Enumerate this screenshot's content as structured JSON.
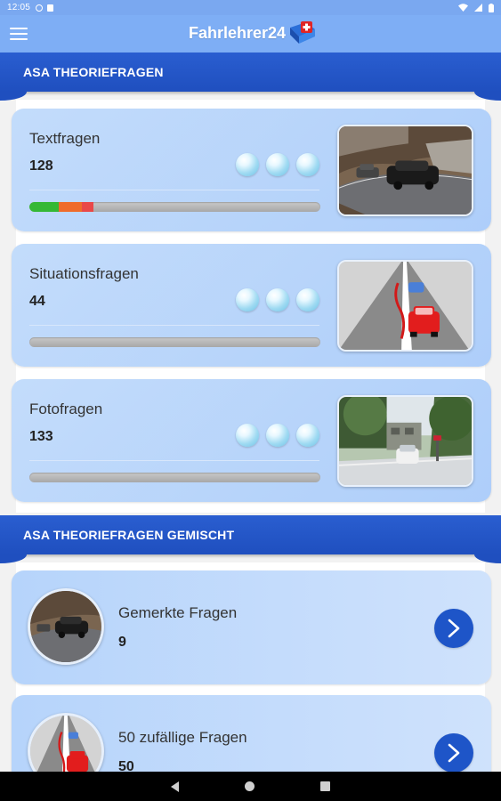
{
  "status_bar": {
    "time": "12:05",
    "icons": [
      "notification-icon",
      "sim-icon",
      "wifi-icon",
      "signal-icon",
      "battery-icon"
    ]
  },
  "app_bar": {
    "title": "Fahrlehrer24",
    "menu_icon": "hamburger-menu-icon",
    "logo_icon": "swiss-flag-logo-icon"
  },
  "sections": {
    "theory": {
      "title": "ASA THEORIEFRAGEN"
    },
    "mixed": {
      "title": "ASA THEORIEFRAGEN GEMISCHT"
    }
  },
  "categories": [
    {
      "title": "Textfragen",
      "count": "128",
      "bubbles": 3,
      "image": "road-car-photo",
      "progress": [
        {
          "color": "#35b835",
          "fraction": 0.1
        },
        {
          "color": "#ef6b2b",
          "fraction": 0.08
        },
        {
          "color": "#e94848",
          "fraction": 0.04
        }
      ]
    },
    {
      "title": "Situationsfragen",
      "count": "44",
      "bubbles": 3,
      "image": "situation-diagram",
      "progress": []
    },
    {
      "title": "Fotofragen",
      "count": "133",
      "bubbles": 3,
      "image": "street-photo",
      "progress": []
    }
  ],
  "mixed": [
    {
      "title": "Gemerkte Fragen",
      "count": "9",
      "image": "road-car-photo",
      "action_icon": "chevron-right-icon"
    },
    {
      "title": "50 zufällige Fragen",
      "count": "50",
      "image": "situation-diagram",
      "action_icon": "chevron-right-icon"
    }
  ],
  "colors": {
    "app_bar": "#7eaef5",
    "section_header": "#1f4fbf",
    "card": "#b6d4fb",
    "arrow_button": "#1e55c8"
  },
  "nav_bar": {
    "icons": [
      "back-icon",
      "home-icon",
      "recents-icon"
    ]
  }
}
